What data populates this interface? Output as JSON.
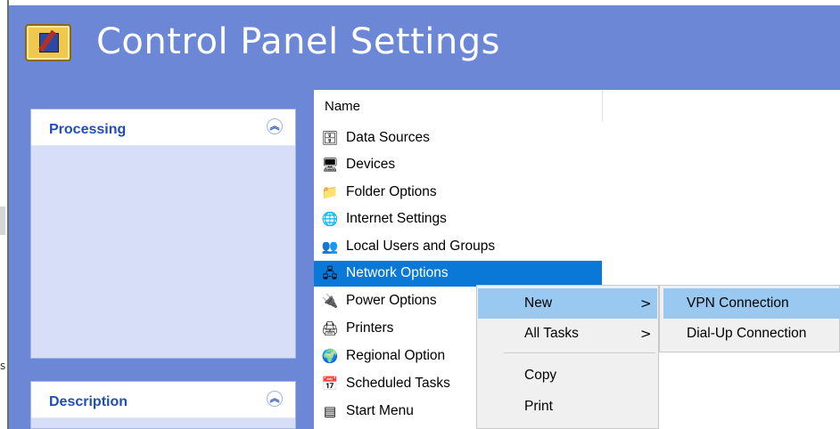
{
  "window": {
    "title": "Control Panel Settings"
  },
  "sidebar": {
    "panels": [
      {
        "label": "Processing",
        "toggle_icon": "chevron-up-double-icon"
      },
      {
        "label": "Description",
        "toggle_icon": "chevron-up-double-icon"
      }
    ]
  },
  "left_edge": {
    "fragment": "s"
  },
  "list": {
    "column_header": "Name",
    "items": [
      {
        "label": "Data Sources",
        "icon": "data-sources-icon",
        "glyph": "🗄"
      },
      {
        "label": "Devices",
        "icon": "devices-icon",
        "glyph": "🖥"
      },
      {
        "label": "Folder Options",
        "icon": "folder-options-icon",
        "glyph": "📁"
      },
      {
        "label": "Internet Settings",
        "icon": "internet-settings-icon",
        "glyph": "🌐"
      },
      {
        "label": "Local Users and Groups",
        "icon": "users-groups-icon",
        "glyph": "👥"
      },
      {
        "label": "Network Options",
        "icon": "network-options-icon",
        "glyph": "🖧",
        "selected": true
      },
      {
        "label": "Power Options",
        "icon": "power-options-icon",
        "glyph": "🔌"
      },
      {
        "label": "Printers",
        "icon": "printers-icon",
        "glyph": "🖨"
      },
      {
        "label": "Regional Option",
        "icon": "regional-option-icon",
        "glyph": "🌍"
      },
      {
        "label": "Scheduled Tasks",
        "icon": "scheduled-tasks-icon",
        "glyph": "📅"
      },
      {
        "label": "Start Menu",
        "icon": "start-menu-icon",
        "glyph": "▤"
      }
    ]
  },
  "context_menu": {
    "items": [
      {
        "label": "New",
        "arrow": ">",
        "highlighted": true
      },
      {
        "label": "All Tasks",
        "arrow": ">"
      },
      {
        "label": "Copy"
      },
      {
        "label": "Print"
      }
    ]
  },
  "submenu": {
    "items": [
      {
        "label": "VPN Connection",
        "highlighted": true
      },
      {
        "label": "Dial-Up Connection"
      }
    ]
  },
  "colors": {
    "banner": "#6b87d6",
    "panel_body": "#d6dff7",
    "panel_title": "#1f4fb5",
    "selection": "#0a78d7",
    "menu_highlight": "#99c9f0",
    "menu_bg": "#f0f0f0"
  }
}
